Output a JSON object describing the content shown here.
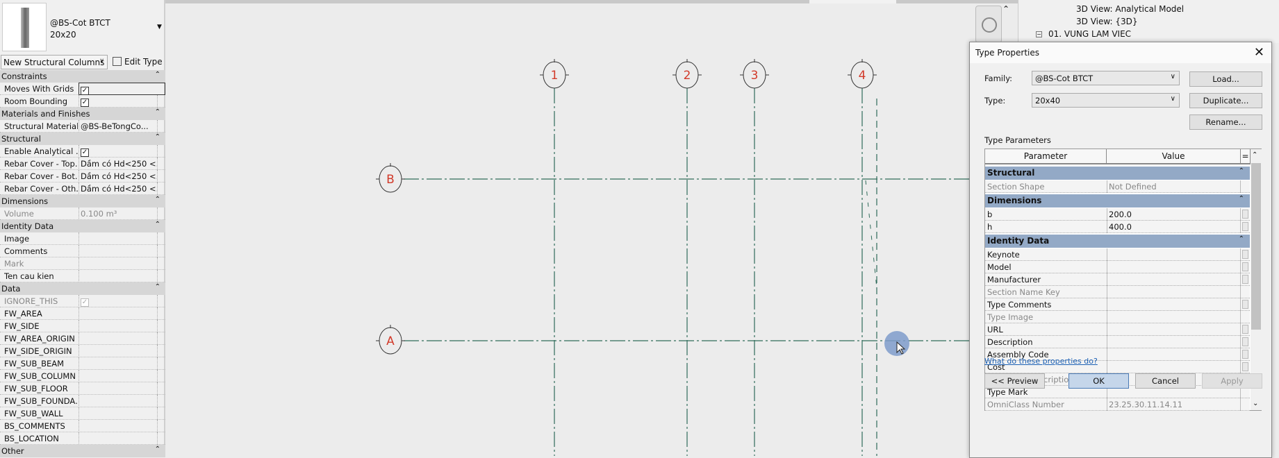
{
  "properties_panel": {
    "type_family": "@BS-Cot BTCT",
    "type_name": "20x20",
    "instance_filter": "New Structural Columns",
    "edit_type_label": "Edit Type",
    "groups": [
      {
        "name": "Constraints",
        "rows": [
          {
            "k": "Moves With Grids",
            "check": true
          },
          {
            "k": "Room Bounding",
            "check": true
          }
        ]
      },
      {
        "name": "Materials and Finishes",
        "rows": [
          {
            "k": "Structural Material",
            "v": "@BS-BeTongCo..."
          }
        ]
      },
      {
        "name": "Structural",
        "rows": [
          {
            "k": "Enable Analytical ...",
            "check": true
          },
          {
            "k": "Rebar Cover - Top...",
            "v": "Dầm có Hd<250 <..."
          },
          {
            "k": "Rebar Cover - Bot...",
            "v": "Dầm có Hd<250 <..."
          },
          {
            "k": "Rebar Cover - Oth...",
            "v": "Dầm có Hd<250 <..."
          }
        ]
      },
      {
        "name": "Dimensions",
        "rows": [
          {
            "k": "Volume",
            "v": "0.100 m³",
            "disabled": true
          }
        ]
      },
      {
        "name": "Identity Data",
        "rows": [
          {
            "k": "Image"
          },
          {
            "k": "Comments"
          },
          {
            "k": "Mark",
            "disabled": true
          },
          {
            "k": "Ten cau kien"
          }
        ]
      },
      {
        "name": "Data",
        "rows": [
          {
            "k": "IGNORE_THIS",
            "check": true,
            "disabled": true
          },
          {
            "k": "FW_AREA"
          },
          {
            "k": "FW_SIDE"
          },
          {
            "k": "FW_AREA_ORIGIN"
          },
          {
            "k": "FW_SIDE_ORIGIN"
          },
          {
            "k": "FW_SUB_BEAM"
          },
          {
            "k": "FW_SUB_COLUMN"
          },
          {
            "k": "FW_SUB_FLOOR"
          },
          {
            "k": "FW_SUB_FOUNDA..."
          },
          {
            "k": "FW_SUB_WALL"
          },
          {
            "k": "BS_COMMENTS"
          },
          {
            "k": "BS_LOCATION"
          }
        ]
      },
      {
        "name": "Other",
        "rows": []
      }
    ]
  },
  "grids": {
    "vertical": [
      "1",
      "2",
      "3",
      "4"
    ],
    "horizontal": [
      "B",
      "A"
    ],
    "line_color": "#2f6b5a",
    "label_color": "#d23a2a"
  },
  "project_browser": {
    "items": [
      "3D View: Analytical Model",
      "3D View: {3D}",
      "01. VUNG LAM VIEC"
    ]
  },
  "dialog": {
    "title": "Type Properties",
    "family_label": "Family:",
    "family_value": "@BS-Cot BTCT",
    "type_label": "Type:",
    "type_value": "20x40",
    "load": "Load...",
    "duplicate": "Duplicate...",
    "rename": "Rename...",
    "params_label": "Type Parameters",
    "col_param": "Parameter",
    "col_value": "Value",
    "col_eq": "=",
    "groups": [
      {
        "name": "Structural",
        "rows": [
          {
            "k": "Section Shape",
            "v": "Not Defined",
            "disabled": true
          }
        ]
      },
      {
        "name": "Dimensions",
        "rows": [
          {
            "k": "b",
            "v": "200.0",
            "sb": true
          },
          {
            "k": "h",
            "v": "400.0",
            "sb": true
          }
        ]
      },
      {
        "name": "Identity Data",
        "rows": [
          {
            "k": "Keynote",
            "sb": true
          },
          {
            "k": "Model",
            "sb": true
          },
          {
            "k": "Manufacturer",
            "sb": true
          },
          {
            "k": "Section Name Key",
            "disabled": true
          },
          {
            "k": "Type Comments",
            "sb": true
          },
          {
            "k": "Type Image",
            "disabled": true
          },
          {
            "k": "URL",
            "sb": true
          },
          {
            "k": "Description",
            "sb": true
          },
          {
            "k": "Assembly Code",
            "sb": true
          },
          {
            "k": "Cost",
            "sb": true
          },
          {
            "k": "Assembly Description",
            "disabled": true
          },
          {
            "k": "Type Mark"
          },
          {
            "k": "OmniClass Number",
            "v": "23.25.30.11.14.11",
            "disabled": true
          }
        ]
      }
    ],
    "help_link": "What do these properties do?",
    "preview": "<< Preview",
    "ok": "OK",
    "cancel": "Cancel",
    "apply": "Apply",
    "accent": "#c5d6ea"
  }
}
